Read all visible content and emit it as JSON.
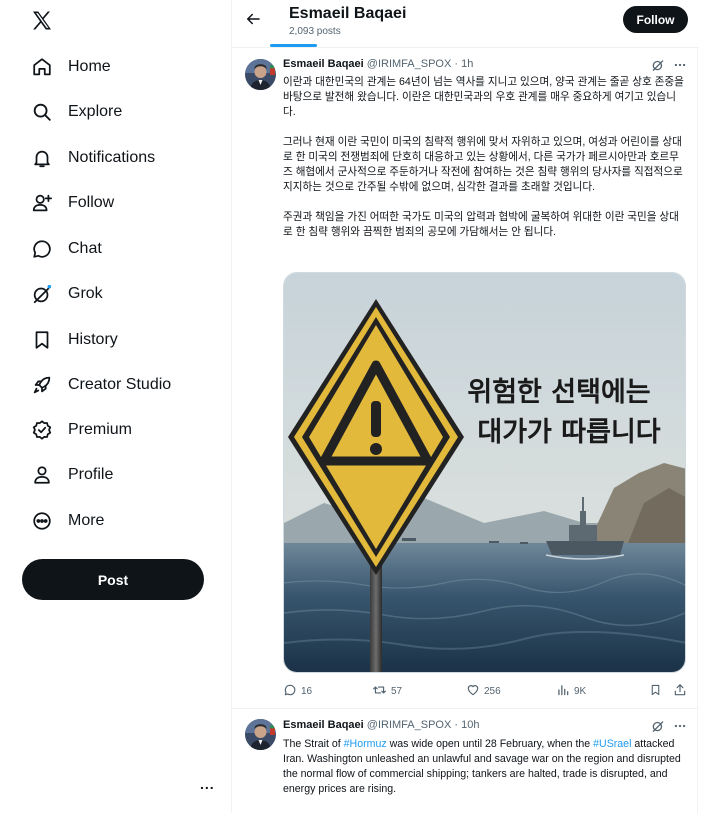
{
  "nav": {
    "items": [
      {
        "label": "Home",
        "icon": "home-icon"
      },
      {
        "label": "Explore",
        "icon": "search-icon"
      },
      {
        "label": "Notifications",
        "icon": "bell-icon"
      },
      {
        "label": "Follow",
        "icon": "add-person-icon"
      },
      {
        "label": "Chat",
        "icon": "chat-bubble-icon"
      },
      {
        "label": "Grok",
        "icon": "grok-icon"
      },
      {
        "label": "History",
        "icon": "bookmark-icon"
      },
      {
        "label": "Creator Studio",
        "icon": "rocket-icon"
      },
      {
        "label": "Premium",
        "icon": "verified-badge-icon"
      },
      {
        "label": "Profile",
        "icon": "person-icon"
      },
      {
        "label": "More",
        "icon": "more-circle-icon"
      }
    ],
    "post_label": "Post",
    "more_dots": "..."
  },
  "header": {
    "name": "Esmaeil Baqaei",
    "count": "2,093 posts",
    "follow_label": "Follow"
  },
  "tweets": [
    {
      "name": "Esmaeil Baqaei",
      "handle": "@IRIMFA_SPOX",
      "sep": "·",
      "time": "1h",
      "paragraphs": [
        "이란과 대한민국의 관계는 64년이 넘는 역사를 지니고 있으며, 양국 관계는 줄곧 상호 존중을 바탕으로 발전해 왔습니다. 이란은 대한민국과의 우호 관계를 매우 중요하게 여기고 있습니다.",
        "그러나 현재 이란 국민이 미국의 침략적 행위에 맞서 자위하고 있으며, 여성과 어린이를 상대로 한 미국의 전쟁범죄에 단호히 대응하고 있는 상황에서, 다른 국가가 페르시아만과 호르무즈 해협에서 군사적으로 주둔하거나 작전에 참여하는 것은 침략 행위의 당사자를 직접적으로 지지하는 것으로 간주될 수밖에 없으며, 심각한 결과를 초래할 것입니다.",
        "주권과 책임을 가진 어떠한 국가도 미국의 압력과 협박에 굴복하여 위대한 이란 국민을 상대로 한 침략 행위와 끔찍한 범죄의 공모에 가담해서는 안 됩니다."
      ],
      "image_text": [
        "위험한 선택에는",
        "대가가 따릅니다"
      ],
      "stats": {
        "replies": "16",
        "reposts": "57",
        "likes": "256",
        "views": "9K"
      }
    },
    {
      "name": "Esmaeil Baqaei",
      "handle": "@IRIMFA_SPOX",
      "sep": "·",
      "time": "10h",
      "text_parts": {
        "t1": "The Strait of ",
        "tag1": "#Hormuz",
        "t2": " was wide open until 28 February, when the ",
        "tag2": "#USrael",
        "t3": " attacked Iran. Washington unleashed an unlawful and savage war on the region and disrupted the normal flow of commercial shipping; tankers are halted, trade is disrupted, and energy prices are rising."
      }
    }
  ],
  "colors": {
    "accent": "#1d9bf0",
    "text": "#0f1419",
    "secondary": "#536471",
    "border": "#eff3f4",
    "sign_yellow": "#e2b93b"
  }
}
